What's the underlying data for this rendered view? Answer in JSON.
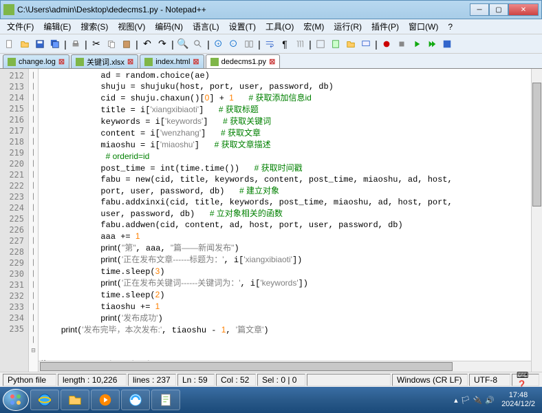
{
  "window": {
    "title": "C:\\Users\\admin\\Desktop\\dedecms1.py - Notepad++"
  },
  "menu": [
    "文件(F)",
    "编辑(E)",
    "搜索(S)",
    "视图(V)",
    "编码(N)",
    "语言(L)",
    "设置(T)",
    "工具(O)",
    "宏(M)",
    "运行(R)",
    "插件(P)",
    "窗口(W)",
    "?"
  ],
  "tabs": [
    {
      "label": "change.log",
      "active": false
    },
    {
      "label": "关键词.xlsx",
      "active": false
    },
    {
      "label": "index.html",
      "active": false
    },
    {
      "label": "dedecms1.py",
      "active": true
    }
  ],
  "lines": [
    {
      "n": 212,
      "ind": "            ",
      "txt": "ad = random.choice(ae)"
    },
    {
      "n": 213,
      "ind": "            ",
      "txt": "shuju = shujuku(host, port, user, password, db)"
    },
    {
      "n": 214,
      "ind": "            ",
      "txt": "cid = shuju.chaxun()[<n>0</n>] + <n>1</n>   <c># 获取添加信息id</c>"
    },
    {
      "n": 215,
      "ind": "            ",
      "txt": "title = i[<s>'xiangxibiaoti'</s>]   <c># 获取标题</c>"
    },
    {
      "n": 216,
      "ind": "            ",
      "txt": "keywords = i[<s>'keywords'</s>]   <c># 获取关键词</c>"
    },
    {
      "n": 217,
      "ind": "            ",
      "txt": "content = i[<s>'wenzhang'</s>]   <c># 获取文章</c>"
    },
    {
      "n": 218,
      "ind": "            ",
      "txt": "miaoshu = i[<s>'miaoshu'</s>]   <c># 获取文章描述</c>"
    },
    {
      "n": 219,
      "ind": "            ",
      "txt": " <c># orderid=id</c>"
    },
    {
      "n": 220,
      "ind": "            ",
      "txt": "post_time = int(time.time())   <c># 获取时间戳</c>"
    },
    {
      "n": 221,
      "ind": "            ",
      "txt": "fabu = new(cid, title, keywords, content, post_time, miaoshu, ad, host,\n            port, user, password, db)   <c># 建立对象</c>"
    },
    {
      "n": 222,
      "ind": "            ",
      "txt": "fabu.addxinxi(cid, title, keywords, post_time, miaoshu, ad, host, port,\n            user, password, db)   <c># 立对象相关的函数</c>"
    },
    {
      "n": 223,
      "ind": "            ",
      "txt": "fabu.addwen(cid, content, ad, host, port, user, password, db)"
    },
    {
      "n": 224,
      "ind": "            ",
      "txt": "aaa += <n>1</n>"
    },
    {
      "n": 225,
      "ind": "            ",
      "txt": "<k>print</k>(<s>\"第\"</s>, aaa, <s>\"篇——新闻发布\"</s>)"
    },
    {
      "n": 226,
      "ind": "            ",
      "txt": "<k>print</k>(<s>'正在发布文章------标题为：'</s>, i[<s>'xiangxibiaoti'</s>])"
    },
    {
      "n": 227,
      "ind": "            ",
      "txt": "time.sleep(<n>3</n>)"
    },
    {
      "n": 228,
      "ind": "            ",
      "txt": "<k>print</k>(<s>'正在发布关键词------关键词为：'</s>, i[<s>'keywords'</s>])"
    },
    {
      "n": 229,
      "ind": "            ",
      "txt": "time.sleep(<n>2</n>)"
    },
    {
      "n": 230,
      "ind": "            ",
      "txt": "tiaoshu += <n>1</n>"
    },
    {
      "n": 231,
      "ind": "            ",
      "txt": "<k>print</k>(<s>'发布成功'</s>)"
    },
    {
      "n": 232,
      "ind": "    ",
      "txt": "<k>print</k>(<s>'发布完毕，本次发布:'</s>, tiaoshu - <n>1</n>, <s>'篇文章'</s>)"
    },
    {
      "n": 233,
      "ind": "",
      "txt": ""
    },
    {
      "n": 234,
      "ind": "",
      "txt": ""
    },
    {
      "n": 235,
      "ind": "",
      "txt": "<k>if</k> __name__ == <s>'__main__'</s>:",
      "fold": "⊟"
    }
  ],
  "status": {
    "filetype": "Python file",
    "length": "length : 10,226",
    "lines": "lines : 237",
    "ln": "Ln : 59",
    "col": "Col : 52",
    "sel": "Sel : 0 | 0",
    "eol": "Windows (CR LF)",
    "enc": "UTF-8"
  },
  "clock": {
    "time": "17:48",
    "date": "2024/12/2"
  }
}
